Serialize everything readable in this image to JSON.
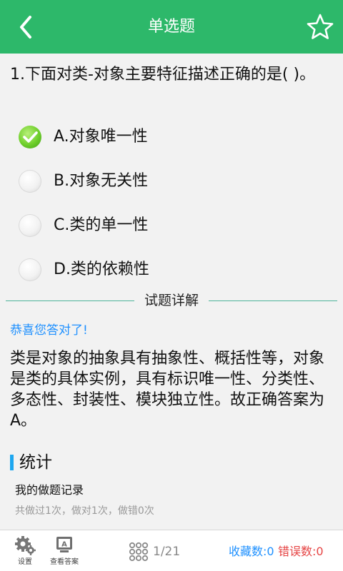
{
  "colors": {
    "header_bg": "#2db86a",
    "accent_blue": "#1e90ff",
    "error_red": "#e64545",
    "divider": "#4cb39a"
  },
  "header": {
    "title": "单选题",
    "back_icon": "chevron-left-icon",
    "favorite_icon": "star-outline-icon"
  },
  "question": {
    "text": "1.下面对类-对象主要特征描述正确的是( )。"
  },
  "options": [
    {
      "label": "A.对象唯一性",
      "checked": true
    },
    {
      "label": "B.对象无关性",
      "checked": false
    },
    {
      "label": "C.类的单一性",
      "checked": false
    },
    {
      "label": "D.类的依赖性",
      "checked": false
    }
  ],
  "detail": {
    "divider_label": "试题详解",
    "correct_message": "恭喜您答对了!",
    "explanation": "类是对象的抽象具有抽象性、概括性等，对象是类的具体实例，具有标识唯一性、分类性、多态性、封装性、模块独立性。故正确答案为A。"
  },
  "stats": {
    "title": "统计",
    "record_title": "我的做题记录",
    "record_text": "共做过1次，做对1次，做错0次"
  },
  "bottom_bar": {
    "settings_label": "设置",
    "settings_icon": "gear-icon",
    "view_answer_label": "查看答案",
    "view_answer_icon": "answer-card-icon",
    "grid_icon": "grid-dots-icon",
    "progress": "1/21",
    "favorites": "收藏数:0",
    "errors": "错误数:0"
  }
}
